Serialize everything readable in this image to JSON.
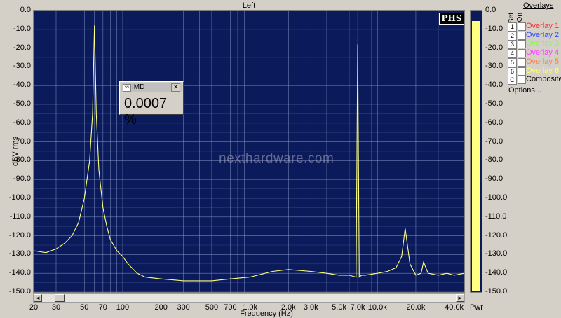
{
  "title": "Left",
  "y_axis": {
    "title": "dBV rms",
    "ticks": [
      "0.0",
      "-10.0",
      "-20.0",
      "-30.0",
      "-40.0",
      "-50.0",
      "-60.0",
      "-70.0",
      "-80.0",
      "-90.0",
      "-100.0",
      "-110.0",
      "-120.0",
      "-130.0",
      "-140.0",
      "-150.0"
    ]
  },
  "x_axis": {
    "title": "Frequency (Hz)",
    "ticks": [
      {
        "label": "20",
        "f": 20
      },
      {
        "label": "30",
        "f": 30
      },
      {
        "label": "50",
        "f": 50
      },
      {
        "label": "70",
        "f": 70
      },
      {
        "label": "100",
        "f": 100
      },
      {
        "label": "200",
        "f": 200
      },
      {
        "label": "300",
        "f": 300
      },
      {
        "label": "500",
        "f": 500
      },
      {
        "label": "700",
        "f": 700
      },
      {
        "label": "1.0k",
        "f": 1000
      },
      {
        "label": "2.0k",
        "f": 2000
      },
      {
        "label": "3.0k",
        "f": 3000
      },
      {
        "label": "5.0k",
        "f": 5000
      },
      {
        "label": "7.0k",
        "f": 7000
      },
      {
        "label": "10.0k",
        "f": 10000
      },
      {
        "label": "20.0k",
        "f": 20000
      },
      {
        "label": "40.0k",
        "f": 40000
      }
    ]
  },
  "chart_data": {
    "type": "line",
    "xlabel": "Frequency (Hz)",
    "ylabel": "dBV rms",
    "xscale": "log",
    "xlim": [
      20,
      48000
    ],
    "ylim": [
      -150,
      0
    ],
    "grid": true,
    "series": [
      {
        "color": "#ffff80",
        "x": [
          20,
          25,
          30,
          35,
          40,
          45,
          50,
          55,
          58,
          60,
          62,
          65,
          70,
          75,
          80,
          90,
          100,
          110,
          130,
          150,
          200,
          300,
          500,
          700,
          1000,
          1500,
          2000,
          3000,
          4000,
          5000,
          6000,
          6800,
          7000,
          7200,
          7500,
          8000,
          10000,
          12000,
          14000,
          15500,
          16500,
          18000,
          20000,
          22000,
          23000,
          25000,
          30000,
          35000,
          40000,
          48000
        ],
        "y": [
          -128,
          -129,
          -127,
          -124,
          -120,
          -113,
          -100,
          -80,
          -55,
          -8,
          -55,
          -85,
          -105,
          -115,
          -122,
          -128,
          -131,
          -135,
          -140,
          -142,
          -143,
          -144,
          -144,
          -143,
          -142,
          -139,
          -138,
          -139,
          -140,
          -141,
          -141,
          -142,
          -18,
          -142,
          -141,
          -141,
          -140,
          -139,
          -137,
          -131,
          -116,
          -135,
          -141,
          -140,
          -134,
          -140,
          -141,
          -140,
          -141,
          -140
        ]
      }
    ],
    "annotations": [
      "0.0007 %"
    ]
  },
  "scrollbar": {
    "left_arrow": "◄",
    "right_arrow": "►"
  },
  "meter": {
    "label": "Pwr",
    "level_dbv": -5,
    "color": "#ffff80"
  },
  "overlays": {
    "title": "Overlays",
    "set_label": "Set",
    "on_label": "On",
    "items": [
      {
        "num": "1",
        "label": "Overlay 1",
        "color": "#ff3030"
      },
      {
        "num": "2",
        "label": "Overlay 2",
        "color": "#3050ff"
      },
      {
        "num": "3",
        "label": "Overlay 3",
        "color": "#80ff40"
      },
      {
        "num": "4",
        "label": "Overlay 4",
        "color": "#ff40ff"
      },
      {
        "num": "5",
        "label": "Overlay 5",
        "color": "#ff8040"
      },
      {
        "num": "6",
        "label": "Overlay 6",
        "color": "#ffff60"
      },
      {
        "num": "C",
        "label": "Composite",
        "color": "#000000"
      }
    ],
    "options_label": "Options..."
  },
  "imd_window": {
    "title": "IMD",
    "value": "0.0007 %",
    "close": "✕",
    "icon": "ss"
  },
  "logo": "PHS",
  "watermark": "nexthardware.com"
}
